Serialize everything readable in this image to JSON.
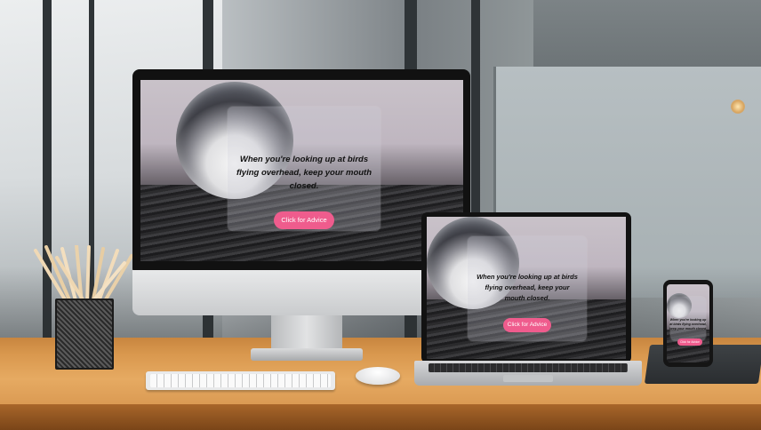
{
  "advice": {
    "quote": "When you're looking up at birds flying overhead, keep your mouth closed.",
    "button_label": "Click for Advice"
  },
  "colors": {
    "button": "#ef5c8d",
    "desk": "#e6aa62"
  }
}
